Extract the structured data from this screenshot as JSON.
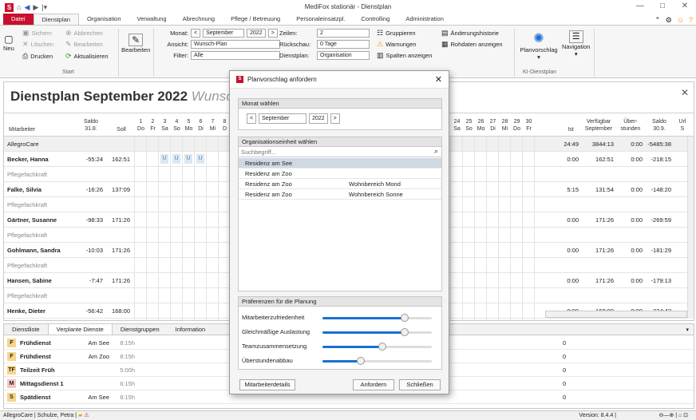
{
  "window": {
    "title": "MediFox stationär - Dienstplan",
    "controls": [
      "—",
      "□",
      "✕"
    ]
  },
  "menu": {
    "tabs": [
      "Datei",
      "Dienstplan",
      "Organisation",
      "Verwaltung",
      "Abrechnung",
      "Pflege / Betreuung",
      "Personaleinsatzpl.",
      "Controlling",
      "Administration"
    ],
    "active": "Dienstplan"
  },
  "ribbon": {
    "neu": "Neu",
    "sichern": "Sichern",
    "abbrechen": "Abbrechen",
    "loeschen": "Löschen",
    "bearbeiten_small": "Bearbeiten",
    "drucken": "Drucken",
    "aktualisieren": "Aktualisieren",
    "bearbeiten": "Bearbeiten",
    "start_label": "Start",
    "monat_label": "Monat:",
    "monat_value": "September",
    "jahr_value": "2022",
    "ansicht_label": "Ansicht:",
    "ansicht_value": "Wunsch-Plan",
    "filter_label": "Filter:",
    "filter_value": "Alle",
    "zeilen_label": "Zeilen:",
    "zeilen_value": "2",
    "rueckschau_label": "Rückschau:",
    "rueckschau_value": "0 Tage",
    "dienstplan_label": "Dienstplan:",
    "dienstplan_value": "Organisation",
    "gruppieren": "Gruppieren",
    "warnungen": "Warnungen",
    "spalten": "Spalten anzeigen",
    "aenderung": "Änderungshistorie",
    "rohdaten": "Rohdaten anzeigen",
    "planvorschlag": "Planvorschlag",
    "navigation": "Navigation",
    "kl_label": "KI-Dienstplan"
  },
  "main": {
    "title": "Dienstplan September 2022",
    "subtitle": "Wunsch-Plan",
    "headers": {
      "mitarbeiter": "Mitarbeiter",
      "saldo": "Saldo",
      "saldo_date": "31.8.",
      "soll": "Soll",
      "ist": "Ist",
      "verfuegbar": "Verfügbar",
      "verfuegbar2": "September",
      "ueber": "Über-",
      "ueber2": "stunden",
      "saldo_r": "Saldo",
      "saldo_r2": "30.9.",
      "url": "Url",
      "url2": "S"
    },
    "days_left": [
      {
        "d": "1",
        "w": "Do"
      },
      {
        "d": "2",
        "w": "Fr"
      },
      {
        "d": "3",
        "w": "Sa"
      },
      {
        "d": "4",
        "w": "So"
      },
      {
        "d": "5",
        "w": "Mo"
      },
      {
        "d": "6",
        "w": "Di"
      },
      {
        "d": "7",
        "w": "Mi"
      },
      {
        "d": "8",
        "w": "D"
      }
    ],
    "days_right": [
      {
        "d": "24",
        "w": "Sa"
      },
      {
        "d": "25",
        "w": "So"
      },
      {
        "d": "26",
        "w": "Mo"
      },
      {
        "d": "27",
        "w": "Di"
      },
      {
        "d": "28",
        "w": "Mi"
      },
      {
        "d": "29",
        "w": "Do"
      },
      {
        "d": "30",
        "w": "Fr"
      }
    ],
    "group": {
      "name": "AllegroCare",
      "ist": "24:49",
      "verf": "3844:13",
      "ueber": "0:00",
      "saldo": "-5485:38"
    },
    "employees": [
      {
        "name": "Becker, Hanna",
        "role": "Pflegefachkraft",
        "saldo": "-55:24",
        "soll": "162:51",
        "ist": "0:00",
        "verf": "162:51",
        "ueber": "0:00",
        "saldo2": "-218:15",
        "u": [
          "U",
          "U",
          "U",
          "U"
        ]
      },
      {
        "name": "Falke, Silvia",
        "role": "Pflegefachkraft",
        "saldo": "-16:26",
        "soll": "137:09",
        "ist": "5:15",
        "verf": "131:54",
        "ueber": "0:00",
        "saldo2": "-148:20"
      },
      {
        "name": "Gärtner, Susanne",
        "role": "Pflegefachkraft",
        "saldo": "-98:33",
        "soll": "171:26",
        "ist": "0:00",
        "verf": "171:26",
        "ueber": "0:00",
        "saldo2": "-269:59"
      },
      {
        "name": "Gohlmann, Sandra",
        "role": "Pflegefachkraft",
        "saldo": "-10:03",
        "soll": "171:26",
        "ist": "0:00",
        "verf": "171:26",
        "ueber": "0:00",
        "saldo2": "-181:29"
      },
      {
        "name": "Hansen, Sabine",
        "role": "Pflegefachkraft",
        "saldo": "-7:47",
        "soll": "171:26",
        "ist": "0:00",
        "verf": "171:26",
        "ueber": "0:00",
        "saldo2": "-179:13"
      },
      {
        "name": "Henke, Dieter",
        "role": "Pflegedienstleitung",
        "saldo": "-56:42",
        "soll": "168:00",
        "ist": "0:00",
        "verf": "168:00",
        "ueber": "0:00",
        "saldo2": "-224:42"
      }
    ]
  },
  "bottom": {
    "tabs": [
      "Dienstliste",
      "Verplante Dienste",
      "Dienstgruppen",
      "Information"
    ],
    "active": "Verplante Dienste",
    "services": [
      {
        "code": "F",
        "name": "Frühdienst",
        "loc": "Am See",
        "dur": "8:15h",
        "count": "0",
        "color": "#f7d48a"
      },
      {
        "code": "F",
        "name": "Frühdienst",
        "loc": "Am Zoo",
        "dur": "8:15h",
        "count": "0",
        "color": "#f7d48a"
      },
      {
        "code": "TF",
        "name": "Teilzeit Früh",
        "loc": "",
        "dur": "5:00h",
        "count": "0",
        "color": "#f7d48a"
      },
      {
        "code": "M",
        "name": "Mittagsdienst 1",
        "loc": "",
        "dur": "6:15h",
        "count": "0",
        "color": "#f5c4c4"
      },
      {
        "code": "S",
        "name": "Spätdienst",
        "loc": "Am See",
        "dur": "8:15h",
        "count": "0",
        "color": "#f7d48a"
      }
    ]
  },
  "statusbar": {
    "left": "AllegroCare | Schulze, Petra |",
    "version": "Version: 8.4.4 |"
  },
  "dialog": {
    "title": "Planvorschlag anfordern",
    "monat_section": "Monat wählen",
    "monat": "September",
    "jahr": "2022",
    "org_section": "Organisationseinheit wählen",
    "search_placeholder": "Suchbegriff...",
    "orgs": [
      {
        "a": "Residenz am See",
        "b": ""
      },
      {
        "a": "Residenz am Zoo",
        "b": ""
      },
      {
        "a": "Residenz am Zoo",
        "b": "Wohnbereich Mond"
      },
      {
        "a": "Residenz am Zoo",
        "b": "Wohnbereich Sonne"
      }
    ],
    "pref_section": "Präferenzen für die Planung",
    "prefs": [
      {
        "label": "Mitarbeiterzufriedenheit",
        "level": 0.75
      },
      {
        "label": "Gleichmäßige Auslastung",
        "level": 0.75
      },
      {
        "label": "Teamzusammensetzung",
        "level": 0.55
      },
      {
        "label": "Überstundenabbau",
        "level": 0.35
      }
    ],
    "btn_details": "Mitarbeiterdetails",
    "btn_anfordern": "Anfordern",
    "btn_schliessen": "Schließen"
  }
}
